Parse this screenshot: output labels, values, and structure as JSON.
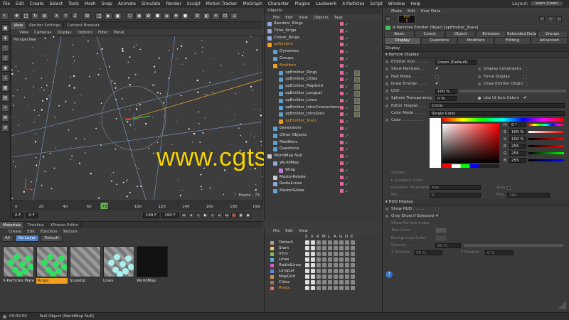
{
  "menubar": {
    "items": [
      "File",
      "Edit",
      "Create",
      "Select",
      "Tools",
      "Mesh",
      "Snap",
      "Animate",
      "Simulate",
      "Render",
      "Sculpt",
      "Motion Tracker",
      "MoGraph",
      "Character",
      "Plugins",
      "Laubwerk",
      "X-Particles",
      "Script",
      "Window",
      "Help"
    ],
    "layout_label": "Layout:",
    "layout_value": "learn (User)"
  },
  "toolbar": {
    "buttons": [
      "↖",
      "✥",
      "□",
      "↻",
      "⊕",
      "X",
      "Y",
      "Z",
      "⊞",
      "◫",
      "▶",
      "▣",
      "⬡",
      "◉",
      "✿",
      "⬢",
      "◈",
      "❖",
      "⬣",
      "⚙",
      "◐",
      "☀",
      "⊡",
      "⌂"
    ]
  },
  "viewport": {
    "tabs": [
      "View",
      "Render Settings",
      "Content Browser"
    ],
    "menu": [
      "View",
      "Cameras",
      "Display",
      "Options",
      "Filter",
      "Panel"
    ],
    "label": "Perspective",
    "frame_text": "Frame : 73"
  },
  "timeline": {
    "ticks": [
      "0",
      "20",
      "40",
      "60",
      "73",
      "100",
      "120",
      "140",
      "160",
      "180",
      "199"
    ],
    "current_frame": "73",
    "current_field": "73 F",
    "start_field": "0 F",
    "left_field": "0 F",
    "end_field": "199 F",
    "end2_field": "199 F"
  },
  "materials": {
    "tabs": [
      "Materials",
      "Timeline",
      "XPresso Editor"
    ],
    "menu": [
      "Create",
      "Edit",
      "Function",
      "Texture"
    ],
    "filters": [
      "All",
      "No Layer",
      "Default"
    ],
    "items": [
      {
        "label": "X-Particles Mate",
        "kind": "green"
      },
      {
        "label": "Rings",
        "kind": "green"
      },
      {
        "label": "ScaleUp",
        "kind": "stripe"
      },
      {
        "label": "Lines",
        "kind": "cyan"
      },
      {
        "label": "WorldMap",
        "kind": "dark"
      }
    ],
    "selected_index": 1
  },
  "objects": {
    "title": "Objects",
    "menu": [
      "File",
      "Edit",
      "View",
      "Objects",
      "Tags"
    ],
    "rows": [
      {
        "name": "Random_Rings",
        "depth": 0,
        "color": "#8fa8d8",
        "hi": false
      },
      {
        "name": "Time_Rings",
        "depth": 0,
        "color": "#8fa8d8",
        "hi": false
      },
      {
        "name": "Cloner_Rings",
        "depth": 0,
        "color": "#8fa8d8",
        "hi": false
      },
      {
        "name": "xpSystem",
        "depth": 0,
        "color": "#f0a020",
        "hi": true
      },
      {
        "name": "Dynamics",
        "depth": 1,
        "color": "#5fa0d0",
        "hi": false
      },
      {
        "name": "Groups",
        "depth": 1,
        "color": "#5fa0d0",
        "hi": false
      },
      {
        "name": "Emitters",
        "depth": 1,
        "color": "#f0a020",
        "hi": true
      },
      {
        "name": "xpEmitter_Rings",
        "depth": 2,
        "color": "#5fa0d0",
        "hi": false
      },
      {
        "name": "xpEmitter_Cities",
        "depth": 2,
        "color": "#5fa0d0",
        "hi": false
      },
      {
        "name": "xpEmitter_MapGrid",
        "depth": 2,
        "color": "#5fa0d0",
        "hi": false
      },
      {
        "name": "xpEmitter_LongLat",
        "depth": 2,
        "color": "#5fa0d0",
        "hi": false
      },
      {
        "name": "xpEmitter_Lines",
        "depth": 2,
        "color": "#5fa0d0",
        "hi": false
      },
      {
        "name": "xpEmitter_IntroConnections",
        "depth": 2,
        "color": "#5fa0d0",
        "hi": false
      },
      {
        "name": "xpEmitter_IntroDots",
        "depth": 2,
        "color": "#5fa0d0",
        "hi": false
      },
      {
        "name": "xpEmitter_Stars",
        "depth": 2,
        "color": "#f0a020",
        "hi": true
      },
      {
        "name": "Generators",
        "depth": 1,
        "color": "#5fa0d0",
        "hi": false
      },
      {
        "name": "Other Objects",
        "depth": 1,
        "color": "#5fa0d0",
        "hi": false
      },
      {
        "name": "Modifiers",
        "depth": 1,
        "color": "#5fa0d0",
        "hi": false
      },
      {
        "name": "Questions",
        "depth": 1,
        "color": "#5fa0d0",
        "hi": false
      },
      {
        "name": "WorldMap Null",
        "depth": 0,
        "color": "#ccc",
        "hi": false
      },
      {
        "name": "WorldMap",
        "depth": 1,
        "color": "#8fa8d8",
        "hi": false
      },
      {
        "name": "Wrap",
        "depth": 2,
        "color": "#c77ad8",
        "hi": false
      },
      {
        "name": "MasterRotate",
        "depth": 1,
        "color": "#ccc",
        "hi": false
      },
      {
        "name": "RadialLines",
        "depth": 1,
        "color": "#8fa8d8",
        "hi": false
      },
      {
        "name": "MasterGlobe",
        "depth": 1,
        "color": "#5fa0d0",
        "hi": false
      }
    ]
  },
  "layers": {
    "menu": [
      "File",
      "Edit",
      "View"
    ],
    "headers": [
      "S",
      "V",
      "R",
      "M",
      "L",
      "A",
      "G",
      "D",
      "E"
    ],
    "rows": [
      {
        "name": "Default",
        "color": "#a0a0a0",
        "hi": false
      },
      {
        "name": "Stars",
        "color": "#e8d048",
        "hi": false
      },
      {
        "name": "Intro",
        "color": "#78c060",
        "hi": false
      },
      {
        "name": "Lines",
        "color": "#58b0e0",
        "hi": false
      },
      {
        "name": "RadialLines",
        "color": "#d060c0",
        "hi": false
      },
      {
        "name": "LongLat",
        "color": "#6088e0",
        "hi": false
      },
      {
        "name": "MapGrid",
        "color": "#d09050",
        "hi": false
      },
      {
        "name": "Cities",
        "color": "#a07850",
        "hi": false
      },
      {
        "name": "Rings",
        "color": "#e07070",
        "hi": true
      }
    ]
  },
  "attributes": {
    "menu": [
      "Mode",
      "Edit",
      "User Data"
    ],
    "logo": "PSR",
    "logo_value": "0",
    "title": "X-Particles Emitter Object [xpEmitter_Stars]",
    "tabs_row1": [
      "Basic",
      "Coord.",
      "Object",
      "Emission",
      "Extended Data",
      "Groups"
    ],
    "tabs_row2": [
      "Display",
      "Questions",
      "Modifiers",
      "Editing",
      "Advanced"
    ],
    "active_tab": "Display",
    "section_display": "Display",
    "section_particle": "▾ Particle Display",
    "emitter_icon_label": "Emitter Icon . . . . .",
    "emitter_icon_value": "Green (Default)",
    "show_particles": "Show Particles . .",
    "display_constraints": "Display Constraints",
    "fast_mode": "Fast Mode . . . . . .",
    "force_display": "Force Display",
    "draw_emitter": "Draw Emitter . . . .",
    "draw_emitter_origin": "Draw Emitter Origin",
    "lod_label": "LOD . . . . . . . . . .",
    "lod_value": "100 %",
    "sphere_label": "Sphere Transparency",
    "sphere_value": "0 %",
    "use_ui_axis": "Use UI Axis Colors",
    "editor_display_label": "Editor Display . . .",
    "editor_display_value": "Circle",
    "color_mode_label": "Color Mode . . . . .",
    "color_mode_value": "Single Color",
    "color_label": "Color . . . . . . . . .",
    "h_label": "H",
    "h_value": "0 °",
    "s_label": "S",
    "s_value": "100 %",
    "v_label": "V",
    "v_value": "100 %",
    "r_label": "R",
    "r_value": "255",
    "g_label": "G",
    "g_value": "255",
    "b_label": "B",
    "b_value": "255",
    "shader_label": "Shader . . . . . . . . .",
    "gradient_color_label": "▸ Gradient Color . .",
    "gradient_param_label": "Gradient Parameter",
    "gradient_param_value": "Age",
    "auto_label": "Auto",
    "min_label": "Min . . . . . .",
    "min_value": "0",
    "max_label": "Max",
    "max_value": "100",
    "section_hud": "▾ HUD Display",
    "show_hud": "Show HUD . . . . .",
    "only_show_selected": "Only Show if Selected",
    "show_particle_index": "Show Particle Index",
    "text_color": "Text Color . . . . .",
    "background_color": "Background Color",
    "opacity_label": "Opacity . . . . . . . .",
    "opacity_value": "85 %",
    "x_pos_label": "X Position",
    "x_pos_value": "45 %",
    "y_pos_label": "Y Position",
    "y_pos_value": "0 %"
  },
  "status": {
    "time": "00:00:00",
    "message": "Null Object [WorldMap Null]"
  },
  "watermark": "www.cgtsj.com"
}
